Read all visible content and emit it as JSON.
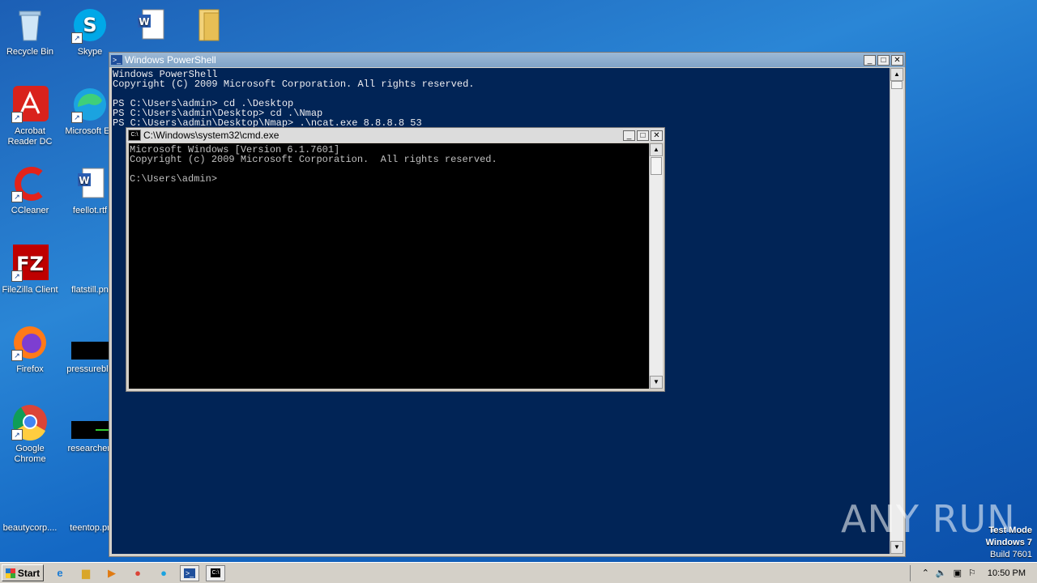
{
  "desktop": {
    "icons": [
      {
        "label": "Recycle Bin"
      },
      {
        "label": "Skype"
      },
      {
        "label": ""
      },
      {
        "label": ""
      },
      {
        "label": "Acrobat Reader DC"
      },
      {
        "label": "Microsoft Ed"
      },
      {
        "label": "CCleaner"
      },
      {
        "label": "feellot.rtf"
      },
      {
        "label": "FileZilla Client"
      },
      {
        "label": "flatstill.pn"
      },
      {
        "label": "Firefox"
      },
      {
        "label": "pressureblu"
      },
      {
        "label": "Google Chrome"
      },
      {
        "label": "researchen"
      },
      {
        "label": "beautycorp...."
      },
      {
        "label": "teentop.pr"
      }
    ]
  },
  "powershell": {
    "title": "Windows PowerShell",
    "output": "Windows PowerShell\nCopyright (C) 2009 Microsoft Corporation. All rights reserved.\n\nPS C:\\Users\\admin> cd .\\Desktop\nPS C:\\Users\\admin\\Desktop> cd .\\Nmap\nPS C:\\Users\\admin\\Desktop\\Nmap> .\\ncat.exe 8.8.8.8 53"
  },
  "cmd": {
    "title": "C:\\Windows\\system32\\cmd.exe",
    "output": "Microsoft Windows [Version 6.1.7601]\nCopyright (c) 2009 Microsoft Corporation.  All rights reserved.\n\nC:\\Users\\admin>"
  },
  "watermark": {
    "text": "ANY RUN"
  },
  "test_mode": {
    "line1": "Test Mode",
    "line2": "Windows 7",
    "line3": "Build 7601"
  },
  "taskbar": {
    "start_label": "Start",
    "clock": "10:50 PM"
  },
  "colors": {
    "powershell_bg": "#012456",
    "cmd_bg": "#000000",
    "desktop_bg": "#1a6cc8"
  }
}
